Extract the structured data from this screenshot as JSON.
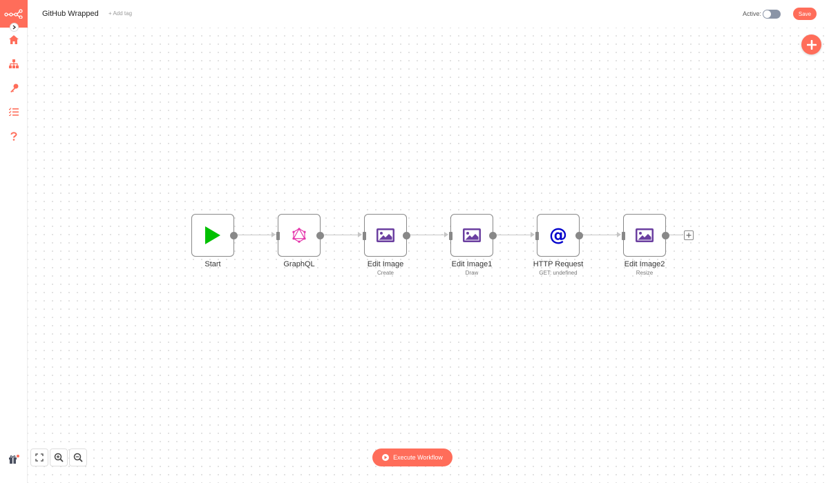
{
  "header": {
    "title": "GitHub Wrapped",
    "add_tag": "+ Add tag",
    "active_label": "Active:",
    "active": false,
    "save_label": "Save"
  },
  "sidebar": {
    "items": [
      {
        "icon": "home-icon"
      },
      {
        "icon": "workflows-icon"
      },
      {
        "icon": "key-icon"
      },
      {
        "icon": "list-icon"
      },
      {
        "icon": "question-icon"
      }
    ]
  },
  "nodes": [
    {
      "name": "Start",
      "subtitle": "",
      "icon": "play-icon"
    },
    {
      "name": "GraphQL",
      "subtitle": "",
      "icon": "graphql-icon"
    },
    {
      "name": "Edit Image",
      "subtitle": "Create",
      "icon": "image-icon"
    },
    {
      "name": "Edit Image1",
      "subtitle": "Draw",
      "icon": "image-icon"
    },
    {
      "name": "HTTP Request",
      "subtitle": "GET: undefined",
      "icon": "at-icon"
    },
    {
      "name": "Edit Image2",
      "subtitle": "Resize",
      "icon": "image-icon"
    }
  ],
  "footer": {
    "execute_label": "Execute Workflow"
  },
  "colors": {
    "accent": "#ff6d5a",
    "image_icon": "#6b3fa0",
    "start_icon": "#00c000",
    "http_icon": "#0000cc",
    "graphql_icon": "#e535ab"
  }
}
